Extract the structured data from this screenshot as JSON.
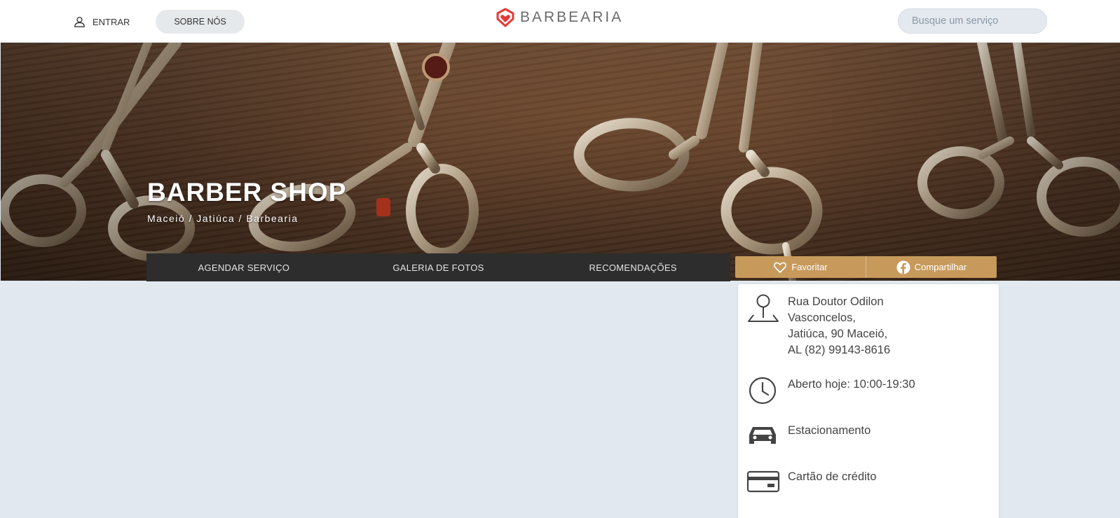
{
  "header": {
    "login_label": "ENTRAR",
    "about_label": "SOBRE NÓS",
    "brand_name": "BARBEARIA",
    "search_placeholder": "Busque um serviço"
  },
  "hero": {
    "title": "BARBER SHOP",
    "breadcrumb": "Maceió / Jatiúca / Barbearia"
  },
  "tabs": [
    {
      "label": "AGENDAR SERVIÇO"
    },
    {
      "label": "GALERIA DE FOTOS"
    },
    {
      "label": "RECOMENDAÇÕES"
    }
  ],
  "actions": {
    "favorite_label": "Favoritar",
    "share_label": "Compartilhar"
  },
  "info": {
    "address_lines": [
      "Rua Doutor Odilon",
      "Vasconcelos,",
      "Jatiúca, 90 Maceió,",
      "AL (82) 99143-8616"
    ],
    "hours": "Aberto hoje: 10:00-19:30",
    "parking": "Estacionamento",
    "payment": "Cartão de crédito"
  },
  "colors": {
    "accent": "#c79a5c",
    "brand": "#e53935",
    "tabs_bg": "#2d2d2d",
    "page_bg": "#e1e8f0"
  },
  "icons": {
    "login": "user-icon",
    "brand": "heart-shield-logo-icon",
    "favorite": "heart-icon",
    "share": "facebook-icon",
    "address": "map-pin-icon",
    "hours": "clock-icon",
    "parking": "car-icon",
    "payment": "credit-card-icon"
  }
}
